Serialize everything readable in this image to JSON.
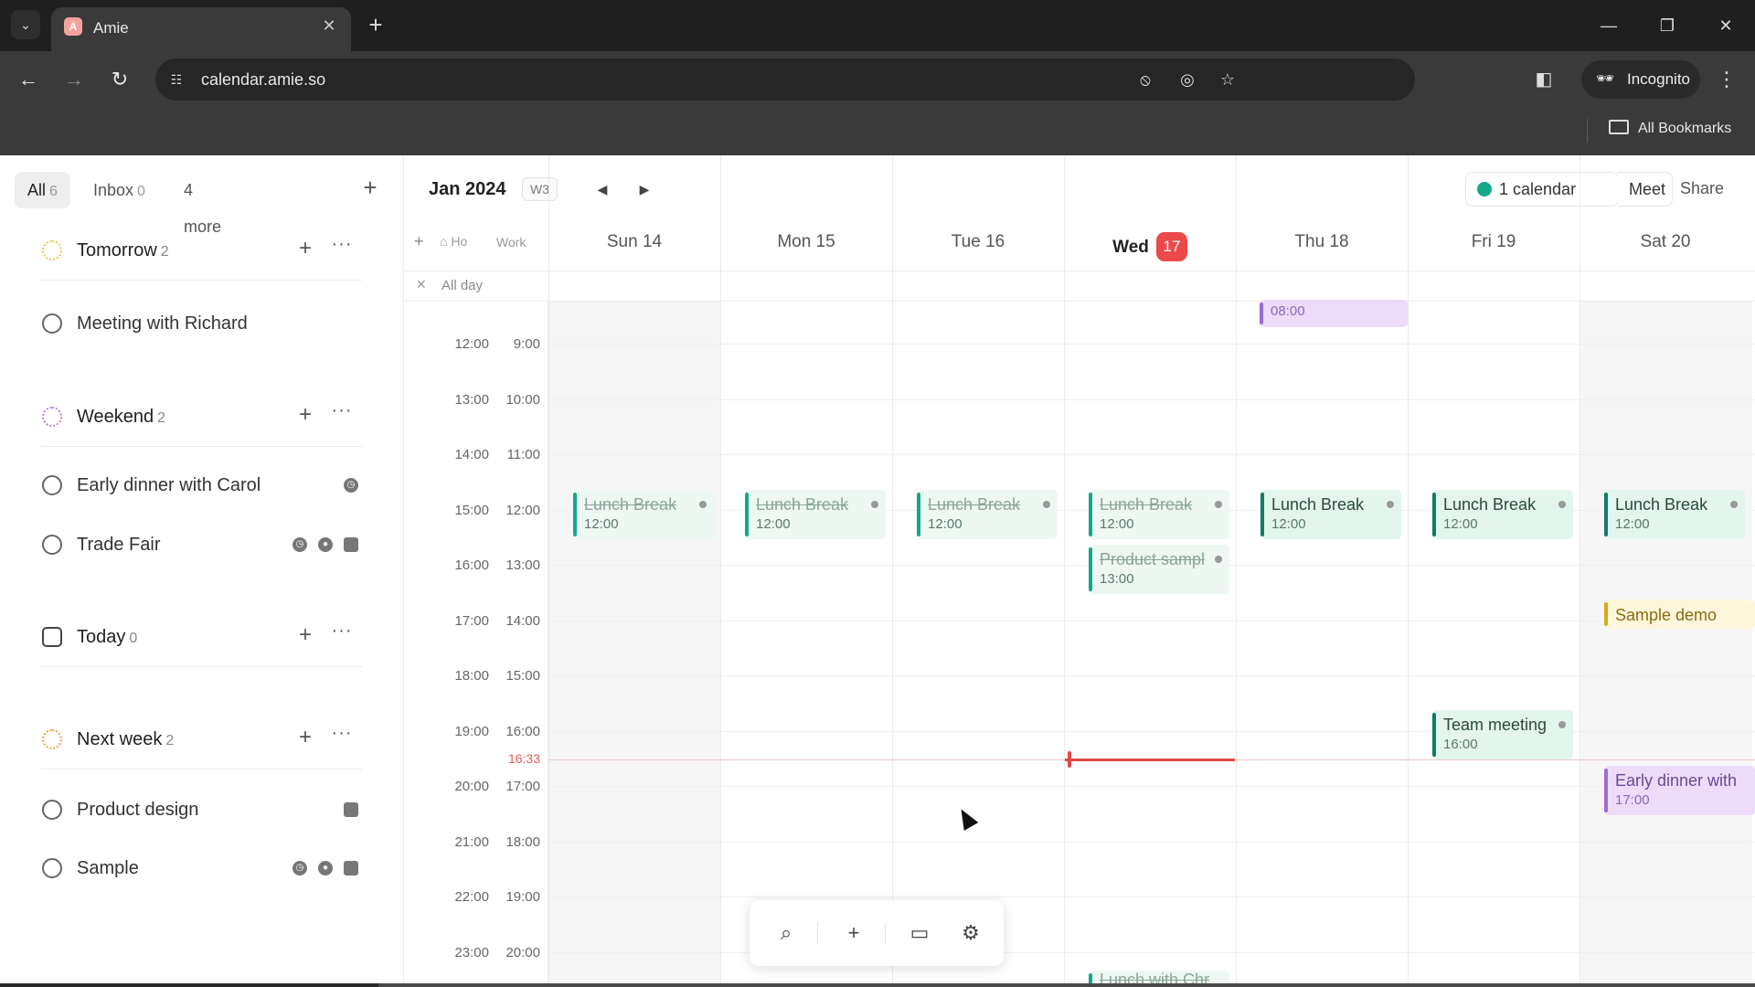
{
  "browser": {
    "tab_title": "Amie",
    "favicon_letter": "A",
    "url": "calendar.amie.so",
    "incognito_label": "Incognito",
    "all_bookmarks": "All Bookmarks"
  },
  "sidebar": {
    "tabs": [
      {
        "label": "All",
        "count": "6"
      },
      {
        "label": "Inbox",
        "count": "0"
      },
      {
        "label": "4 more"
      }
    ],
    "groups": [
      {
        "title": "Tomorrow",
        "count": "2",
        "icon_color": "#f0c44c"
      },
      {
        "title": "Weekend",
        "count": "2",
        "icon_color": "#b27ee0"
      },
      {
        "title": "Today",
        "count": "0",
        "icon_color": "#444444"
      },
      {
        "title": "Next week",
        "count": "2",
        "icon_color": "#f0a13c"
      }
    ],
    "tasks": [
      {
        "label": "Meeting with Richard"
      },
      {
        "label": "Early dinner with Carol"
      },
      {
        "label": "Trade Fair"
      },
      {
        "label": "Product design"
      },
      {
        "label": "Sample"
      }
    ]
  },
  "calendar": {
    "title": "Jan 2024",
    "week": "W3",
    "calendars_label": "1 calendar",
    "meet_label": "Meet",
    "share_label": "Share",
    "tz_home": "Ho",
    "tz_work": "Work",
    "allday_label": "All day",
    "days": [
      {
        "label": "Sun 14"
      },
      {
        "label": "Mon 15"
      },
      {
        "label": "Tue 16"
      },
      {
        "label": "Wed",
        "badge": "17"
      },
      {
        "label": "Thu 18"
      },
      {
        "label": "Fri 19"
      },
      {
        "label": "Sat 20"
      }
    ],
    "hours_tz1": [
      "12:00",
      "13:00",
      "14:00",
      "15:00",
      "16:00",
      "17:00",
      "18:00",
      "19:00",
      "20:00",
      "21:00",
      "22:00",
      "23:00"
    ],
    "hours_tz2": [
      "9:00",
      "10:00",
      "11:00",
      "12:00",
      "13:00",
      "14:00",
      "15:00",
      "16:00",
      "17:00",
      "18:00",
      "19:00",
      "20:00"
    ],
    "now_label": "16:33",
    "events": {
      "thu_morning": {
        "time": "08:00"
      },
      "lunch": {
        "title": "Lunch Break",
        "time": "12:00"
      },
      "product_sample": {
        "title": "Product sampl",
        "time": "13:00"
      },
      "sample_demo": {
        "title": "Sample demo"
      },
      "team_meeting": {
        "title": "Team meeting",
        "time": "16:00"
      },
      "early_dinner": {
        "title": "Early dinner with",
        "time": "17:00"
      },
      "lunch_chris": {
        "title": "Lunch with Chris"
      }
    }
  },
  "colors": {
    "accent_green": "#14a88a",
    "today_red": "#ec4a4a",
    "event_purple": "#9b6ad8",
    "event_yellow": "#d7a91a"
  },
  "icons": {
    "search": "search-icon",
    "add": "plus-icon",
    "layout": "sidebar-layout-icon",
    "settings": "gear-icon"
  }
}
